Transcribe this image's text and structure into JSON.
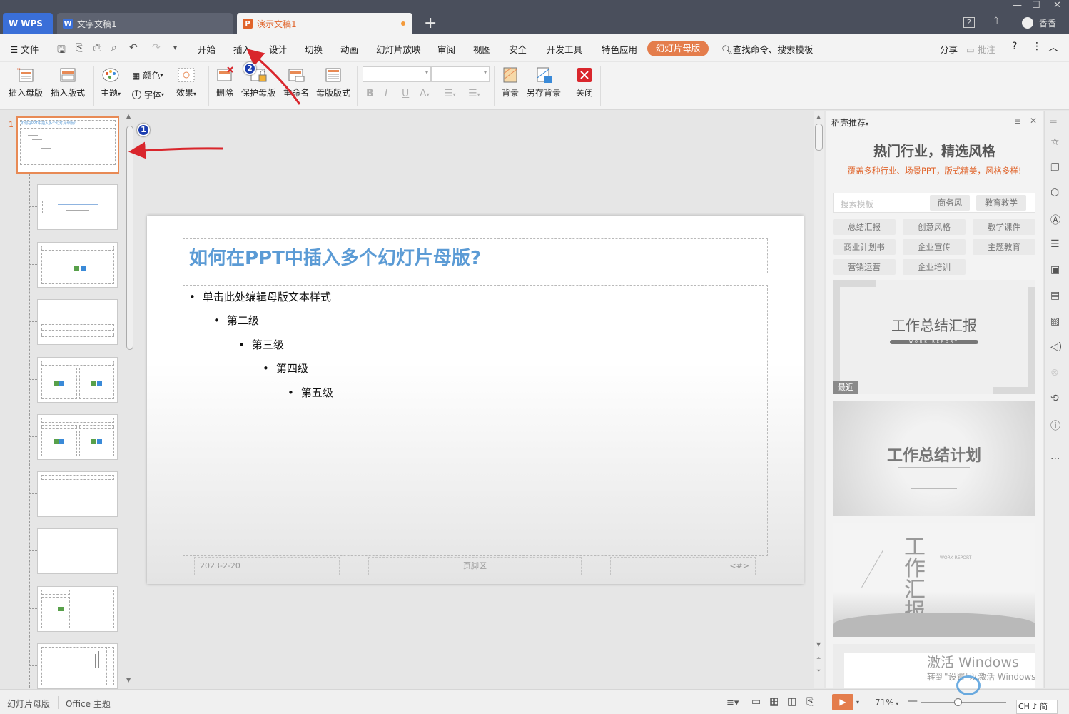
{
  "titlebar": {
    "tabs": [
      {
        "label": "WPS"
      },
      {
        "label": "文字文稿1"
      },
      {
        "label": "演示文稿1"
      }
    ],
    "window_controls": {
      "box_count": "2"
    },
    "account": "香香"
  },
  "menubar": {
    "file": "文件",
    "items": [
      "开始",
      "插入",
      "设计",
      "切换",
      "动画",
      "幻灯片放映",
      "审阅",
      "视图",
      "安全",
      "开发工具",
      "特色应用"
    ],
    "active": "幻灯片母版",
    "search": "查找命令、搜索模板",
    "share": "分享",
    "comment": "批注"
  },
  "ribbon": {
    "insert_master": "插入母版",
    "insert_layout": "插入版式",
    "theme": "主题",
    "color": "颜色",
    "font": "字体",
    "effect": "效果",
    "delete": "删除",
    "protect_master": "保护母版",
    "rename": "重命名",
    "master_layout": "母版版式",
    "background": "背景",
    "save_background": "另存背景",
    "close": "关闭"
  },
  "slide_panel": {
    "master_number": "1",
    "master_thumb_title": "如何在PPT中插入多个幻灯片母版？"
  },
  "slide": {
    "title": "如何在PPT中插入多个幻灯片母版?",
    "levels": [
      "单击此处编辑母版文本样式",
      "第二级",
      "第三级",
      "第四级",
      "第五级"
    ],
    "footer_date": "2023-2-20",
    "footer_text": "页脚区",
    "footer_number": "<#>"
  },
  "right_panel": {
    "header": "稻壳推荐",
    "headline": "热门行业，精选风格",
    "subline": "覆盖多种行业、场景PPT，版式精美，风格多样!",
    "search_placeholder": "搜索模板",
    "search_tags": [
      "商务风",
      "教育教学"
    ],
    "categories": [
      "总结汇报",
      "创意风格",
      "教学课件",
      "商业计划书",
      "企业宣传",
      "主题教育",
      "营销运营",
      "企业培训"
    ],
    "templates": [
      {
        "title": "工作总结汇报",
        "subtitle": "WORK REPORT",
        "badge": "最近"
      },
      {
        "title": "工作总结计划"
      },
      {
        "title": "工作汇报",
        "subtitle": "WORK  REPORT"
      }
    ],
    "watermark_line1": "激活 Windows",
    "watermark_line2": "转到\"设置\"以激活 Windows"
  },
  "statusbar": {
    "mode": "幻灯片母版",
    "theme": "Office 主题",
    "zoom": "71%",
    "ime": "CH ♪ 简"
  },
  "annotations": {
    "badge1": "1",
    "badge2": "2",
    "arrow_color": "#d9262c"
  },
  "colors": {
    "accent": "#e47d4c",
    "title_blue": "#5b9bd5",
    "tab_ppt": "#e0642b"
  }
}
